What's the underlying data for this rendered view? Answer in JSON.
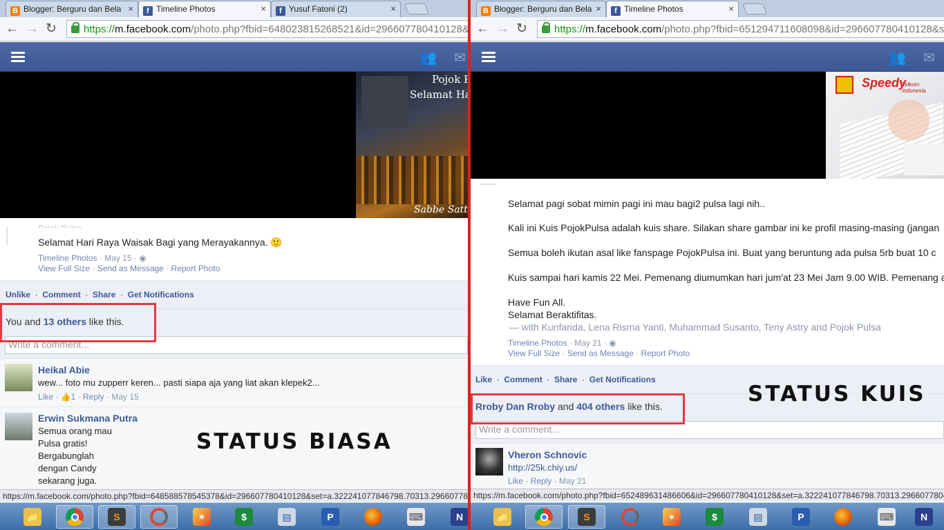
{
  "left": {
    "tabs": [
      {
        "title": "Blogger: Berguru dan Bela",
        "icon": "blogger",
        "active": false
      },
      {
        "title": "Timeline Photos",
        "icon": "facebook",
        "active": true
      },
      {
        "title": "Yusuf Fatoni (2)",
        "icon": "facebook",
        "active": false
      }
    ],
    "url": {
      "scheme": "https://",
      "host": "m.facebook.com",
      "rest": "/photo.php?fbid=648023815268521&id=296607780410128&set=a.322241077846798.70313.2966077804"
    },
    "photo_text": {
      "line1": "Pojok P",
      "line2": "Selamat Ha",
      "signature": "Sabbe Satt"
    },
    "post": {
      "author_partial": "Pojok Pulsa",
      "message": "Selamat Hari Raya Waisak Bagi yang Merayakannya. 🙂",
      "meta_album": "Timeline Photos",
      "meta_date": "· May 15 ·",
      "actions": [
        "View Full Size",
        "Send as Message",
        "Report Photo"
      ]
    },
    "action_bar": [
      "Unlike",
      "Comment",
      "Share",
      "Get Notifications"
    ],
    "likes": {
      "prefix": "You and ",
      "count_link": "13 others",
      "suffix": " like this."
    },
    "comment_placeholder": "Write a comment...",
    "comments": [
      {
        "name": "Heikal Abie",
        "lines": [
          "wew... foto mu zupperr keren... pasti siapa aja yang liat akan klepek2..."
        ],
        "like": "Like",
        "likes_count": "1",
        "reply": "Reply",
        "date": "May 15"
      },
      {
        "name": "Erwin Sukmana Putra",
        "lines": [
          "Semua orang mau",
          "Pulsa gratis!",
          "Bergabunglah",
          "dengan Candy",
          "sekarang juga."
        ]
      }
    ],
    "caption": "STATUS BIASA",
    "status_url": "https://m.facebook.com/photo.php?fbid=648588578545378&id=296607780410128&set=a.322241077846798.70313.296607780410"
  },
  "right": {
    "tabs": [
      {
        "title": "Blogger: Berguru dan Bela",
        "icon": "blogger",
        "active": false
      },
      {
        "title": "Timeline Photos",
        "icon": "facebook",
        "active": true
      }
    ],
    "url": {
      "scheme": "https://",
      "host": "m.facebook.com",
      "rest": "/photo.php?fbid=651294711608098&id=296607780410128&set=a.322241077846798.70313.296607780410128&type"
    },
    "photo_text": {
      "brand": "Speedy",
      "sub": "Telkom Indonesia"
    },
    "post": {
      "paragraphs": [
        "Selamat pagi sobat                  mimin pagi ini mau bagi2 pulsa lagi nih..",
        "Kali ini Kuis PojokPulsa adalah kuis share. Silakan share gambar ini ke profil masing-masing (jangan",
        "Semua boleh ikutan asal like fanspage PojokPulsa ini. Buat yang beruntung ada pulsa 5rb buat 10 c",
        "Kuis sampai hari kamis 22 Mei. Pemenang diumumkan hari jum'at 23 Mei Jam 9.00 WIB. Pemenang a"
      ],
      "closing1": "Have Fun All.",
      "closing2": "Selamat Beraktifitas.",
      "with_line": "—  with Kunfarida, Lena Risma Yanti, Muhammad Susanto, Teny Astry and Pojok Pulsa",
      "meta_album": "Timeline Photos",
      "meta_date": "· May 21 ·",
      "actions": [
        "View Full Size",
        "Send as Message",
        "Report Photo"
      ]
    },
    "action_bar": [
      "Like",
      "Comment",
      "Share",
      "Get Notifications"
    ],
    "likes": {
      "name_link": "Rroby Dan Rroby",
      "middle": " and ",
      "count_link": "404 others",
      "suffix": " like this."
    },
    "comment_placeholder": "Write a comment...",
    "comments": [
      {
        "name": "Vheron Schnovic",
        "link": "http://25k.chiy.us/",
        "like": "Like",
        "reply": "Reply",
        "date": "May 21"
      }
    ],
    "caption": "STATUS KUIS",
    "status_url": "https://m.facebook.com/photo.php?fbid=652489631486606&id=296607780410128&set=a.322241077846798.70313.296607780410128"
  },
  "taskbar": {
    "items": [
      "windows-explorer",
      "chrome",
      "sublime-text",
      "app-swirl",
      "paint-app",
      "spreadsheet-app",
      "network-monitor",
      "publisher-app",
      "firefox",
      "device-manager",
      "onenote"
    ],
    "active": [
      "chrome",
      "sublime-text",
      "app-swirl"
    ]
  },
  "colors": {
    "fb_blue": "#3b5998",
    "highlight": "#e2393f",
    "divider": "#e0201c"
  }
}
